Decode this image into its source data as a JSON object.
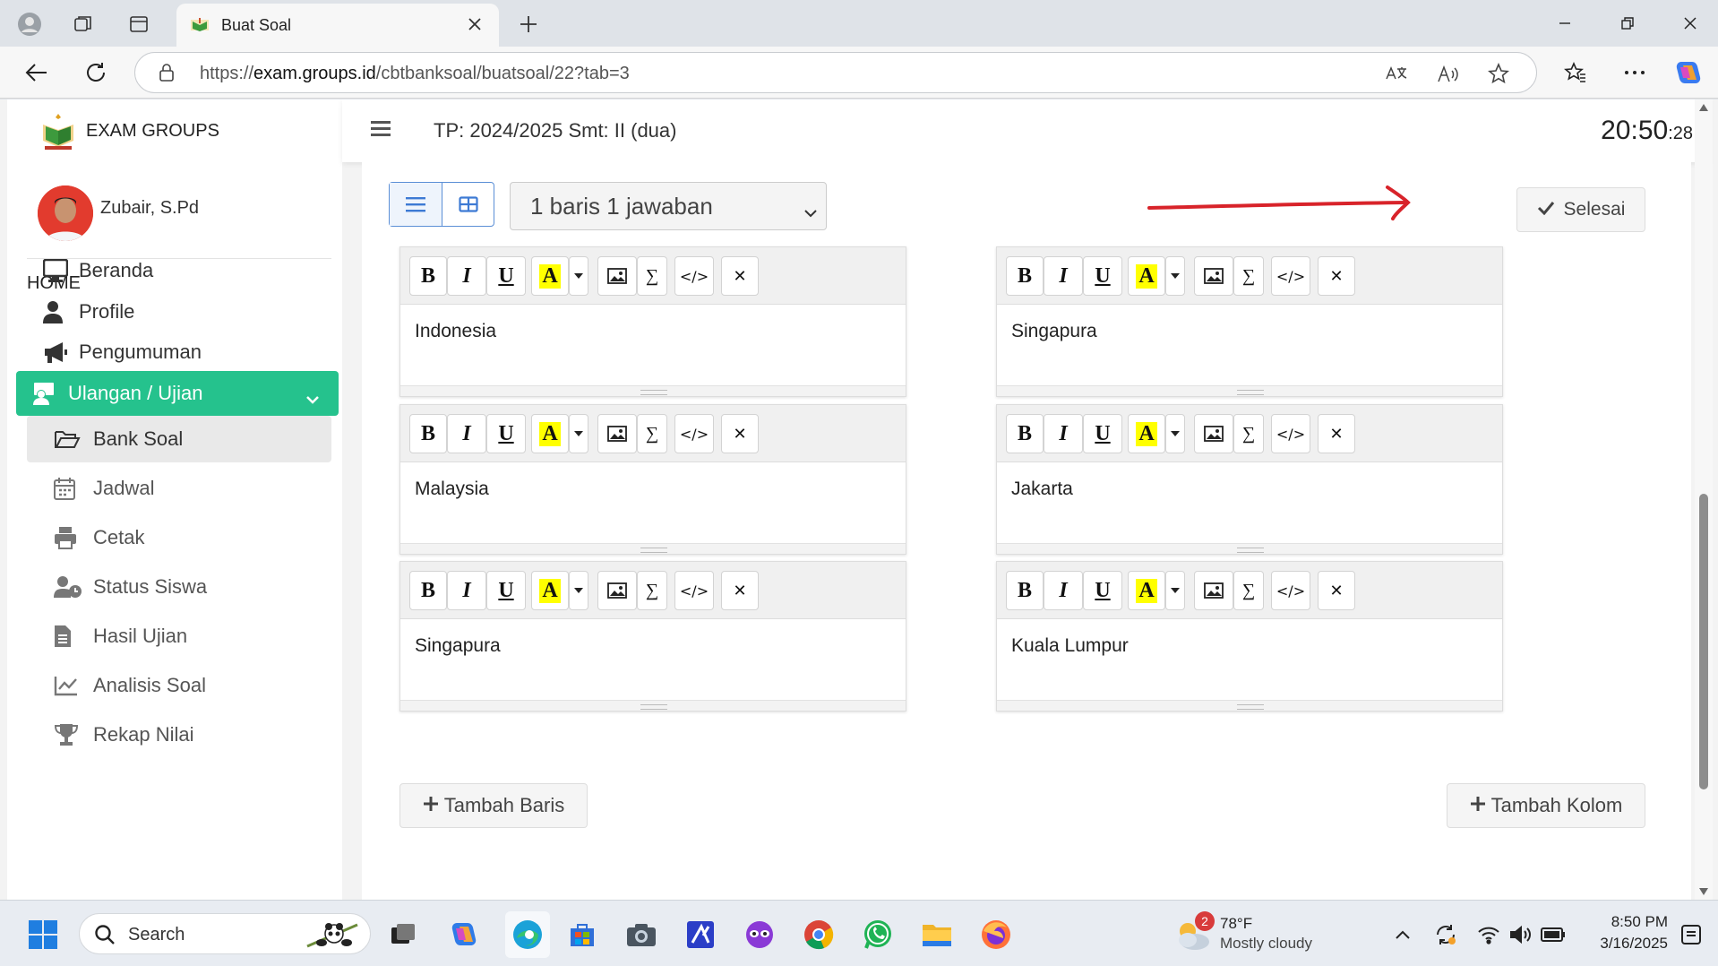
{
  "browser": {
    "tab_title": "Buat Soal",
    "url_prefix": "https://",
    "url_host": "exam.groups.id",
    "url_path": "/cbtbanksoal/buatsoal/22?tab=3"
  },
  "sidebar": {
    "brand": "EXAM GROUPS",
    "user_name": "Zubair, S.Pd",
    "home_header": "HOME",
    "menu": [
      {
        "label": "Beranda",
        "icon": "monitor-icon"
      },
      {
        "label": "Profile",
        "icon": "user-icon"
      },
      {
        "label": "Pengumuman",
        "icon": "megaphone-icon"
      },
      {
        "label": "Ulangan / Ujian",
        "icon": "teacher-icon"
      }
    ],
    "submenu": [
      {
        "label": "Bank Soal",
        "icon": "folder-open-icon"
      },
      {
        "label": "Jadwal",
        "icon": "calendar-icon"
      },
      {
        "label": "Cetak",
        "icon": "print-icon"
      },
      {
        "label": "Status Siswa",
        "icon": "user-clock-icon"
      },
      {
        "label": "Hasil Ujian",
        "icon": "file-icon"
      },
      {
        "label": "Analisis Soal",
        "icon": "chart-line-icon"
      },
      {
        "label": "Rekap Nilai",
        "icon": "trophy-icon"
      }
    ],
    "accent_color": "#25c28d"
  },
  "topbar": {
    "tp_text": "TP: 2024/2025 Smt: II (dua)",
    "clock_main": "20:50",
    "clock_seconds": ":28"
  },
  "content": {
    "select_value": "1 baris 1 jawaban",
    "selesai_label": "Selesai",
    "add_row_label": "Tambah Baris",
    "add_col_label": "Tambah Kolom",
    "editors_left": [
      "Indonesia",
      "Malaysia",
      "Singapura"
    ],
    "editors_right": [
      "Singapura",
      "Jakarta",
      "Kuala Lumpur"
    ],
    "toolbar": {
      "bold": "B",
      "italic": "I",
      "underline": "U",
      "highlight": "A",
      "sigma": "∑",
      "code": "</>",
      "remove": "✕"
    }
  },
  "taskbar": {
    "search_placeholder": "Search",
    "weather_badge": "2",
    "weather_temp": "78°F",
    "weather_desc": "Mostly cloudy",
    "time": "8:50 PM",
    "date": "3/16/2025"
  }
}
